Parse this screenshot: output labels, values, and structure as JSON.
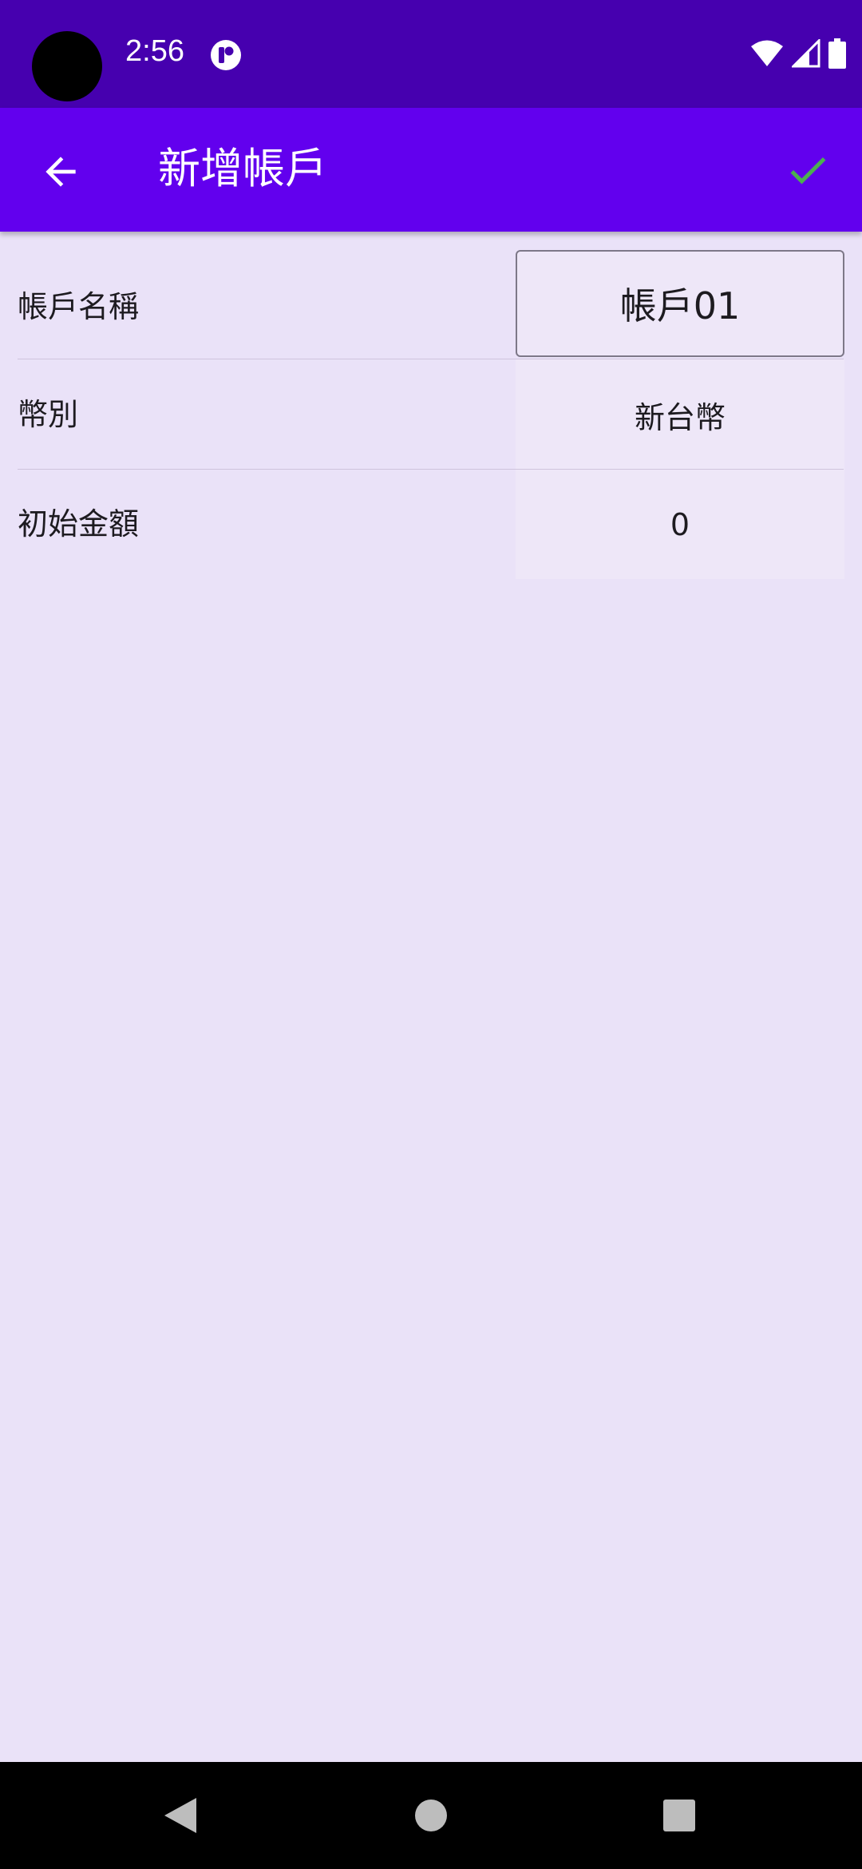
{
  "status_bar": {
    "time": "2:56",
    "icons": [
      "app-notification-icon",
      "wifi-icon",
      "cell-signal-icon",
      "battery-icon"
    ]
  },
  "app_bar": {
    "title": "新增帳戶",
    "back_icon": "arrow-back-icon",
    "confirm_icon": "check-icon",
    "colors": {
      "background": "#6200EE",
      "confirm": "#4CAF50"
    }
  },
  "form": {
    "rows": [
      {
        "label": "帳戶名稱",
        "value": "帳戶01"
      },
      {
        "label": "幣別",
        "value": "新台幣"
      },
      {
        "label": "初始金額",
        "value": "0"
      }
    ]
  },
  "nav_bar": {
    "icons": [
      "back-triangle-icon",
      "home-circle-icon",
      "recents-square-icon"
    ]
  }
}
